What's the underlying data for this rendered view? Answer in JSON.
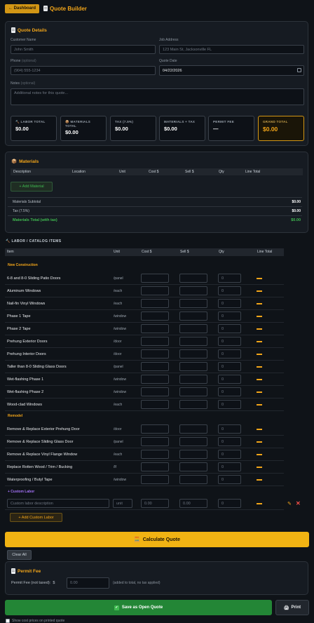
{
  "header": {
    "back_label": "← Dashboard",
    "title": "Quote Builder"
  },
  "quote_details": {
    "title": "Quote Details",
    "customer_name_label": "Customer Name",
    "customer_name_placeholder": "John Smith",
    "job_address_label": "Job Address",
    "job_address_placeholder": "123 Main St, Jacksonville FL",
    "phone_label": "Phone",
    "phone_optional": "(optional)",
    "phone_placeholder": "(904) 555-1234",
    "quote_date_label": "Quote Date",
    "quote_date_value": "04/22/2026",
    "notes_label": "Notes",
    "notes_optional": "(optional)",
    "notes_placeholder": "Additional notes for this quote..."
  },
  "stats": [
    {
      "icon": "hammer-icon",
      "label": "LABOR TOTAL",
      "value": "$0.00"
    },
    {
      "icon": "box-icon",
      "label": "MATERIALS TOTAL",
      "value": "$0.00"
    },
    {
      "icon": "",
      "label": "TAX (7.5%)",
      "value": "$0.00"
    },
    {
      "icon": "",
      "label": "MATERIALS + TAX",
      "value": "$0.00"
    },
    {
      "icon": "",
      "label": "PERMIT FEE",
      "value": "—"
    },
    {
      "icon": "",
      "label": "GRAND TOTAL",
      "value": "$0.00"
    }
  ],
  "materials": {
    "title": "Materials",
    "columns": [
      "Description",
      "Location",
      "Unit",
      "Cost $",
      "Sell $",
      "Qty",
      "Line Total"
    ],
    "add_label": "+ Add Material",
    "subtotal_label": "Materials Subtotal",
    "subtotal_value": "$0.00",
    "tax_label": "Tax (7.5%)",
    "tax_value": "$0.00",
    "total_label": "Materials Total (with tax)",
    "total_value": "$0.00"
  },
  "labor": {
    "section_title": "LABOR / CATALOG ITEMS",
    "columns": [
      "Item",
      "Unit",
      "Cost $",
      "Sell $",
      "Qty",
      "Line Total"
    ],
    "categories": [
      {
        "name": "New Construction",
        "items": [
          {
            "name": "6-8 and 8-0 Sliding Patio Doors",
            "unit": "/panel",
            "qty": "0"
          },
          {
            "name": "Aluminum Windows",
            "unit": "/each",
            "qty": "0"
          },
          {
            "name": "Nail-fin Vinyl Windows",
            "unit": "/each",
            "qty": "0"
          },
          {
            "name": "Phase 1 Tape",
            "unit": "/window",
            "qty": "0"
          },
          {
            "name": "Phase 2 Tape",
            "unit": "/window",
            "qty": "0"
          },
          {
            "name": "Prehung Exterior Doors",
            "unit": "/door",
            "qty": "0"
          },
          {
            "name": "Prehung Interior Doors",
            "unit": "/door",
            "qty": "0"
          },
          {
            "name": "Taller than 8-0 Sliding Glass Doors",
            "unit": "/panel",
            "qty": "0"
          },
          {
            "name": "Wet-flashing Phase 1",
            "unit": "/window",
            "qty": "0"
          },
          {
            "name": "Wet-flashing Phase 2",
            "unit": "/window",
            "qty": "0"
          },
          {
            "name": "Wood-clad Windows",
            "unit": "/each",
            "qty": "0"
          }
        ]
      },
      {
        "name": "Remodel",
        "items": [
          {
            "name": "Remove & Replace Exterior Prehung Door",
            "unit": "/door",
            "qty": "0"
          },
          {
            "name": "Remove & Replace Sliding Glass Door",
            "unit": "/panel",
            "qty": "0"
          },
          {
            "name": "Remove & Replace Vinyl Flange Window",
            "unit": "/each",
            "qty": "0"
          },
          {
            "name": "Replace Rotten Wood / Trim / Bucking",
            "unit": "/lf",
            "qty": "0"
          },
          {
            "name": "Waterproofing / Butyl Tape",
            "unit": "/window",
            "qty": "0"
          }
        ]
      }
    ],
    "custom_header": "+ Custom Labor",
    "custom_row": {
      "description_placeholder": "Custom labor description",
      "unit_placeholder": "unit",
      "cost_placeholder": "0.00",
      "sell_placeholder": "0.00",
      "qty_placeholder": "0"
    },
    "add_custom_label": "+ Add Custom Labor"
  },
  "actions": {
    "calculate_label": "Calculate Quote",
    "clear_label": "Clear All",
    "save_label": "Save as Open Quote",
    "print_label": "Print",
    "show_cost_label": "Show cost prices on printed quote"
  },
  "permit": {
    "title": "Permit Fee",
    "label": "Permit Fee (not taxed):",
    "currency": "$",
    "placeholder": "0.00",
    "note": "(added to total, no tax applied)"
  },
  "colors": {
    "accent": "#f2a519",
    "green": "#238636",
    "background": "#0f1318",
    "card": "#161b22"
  }
}
